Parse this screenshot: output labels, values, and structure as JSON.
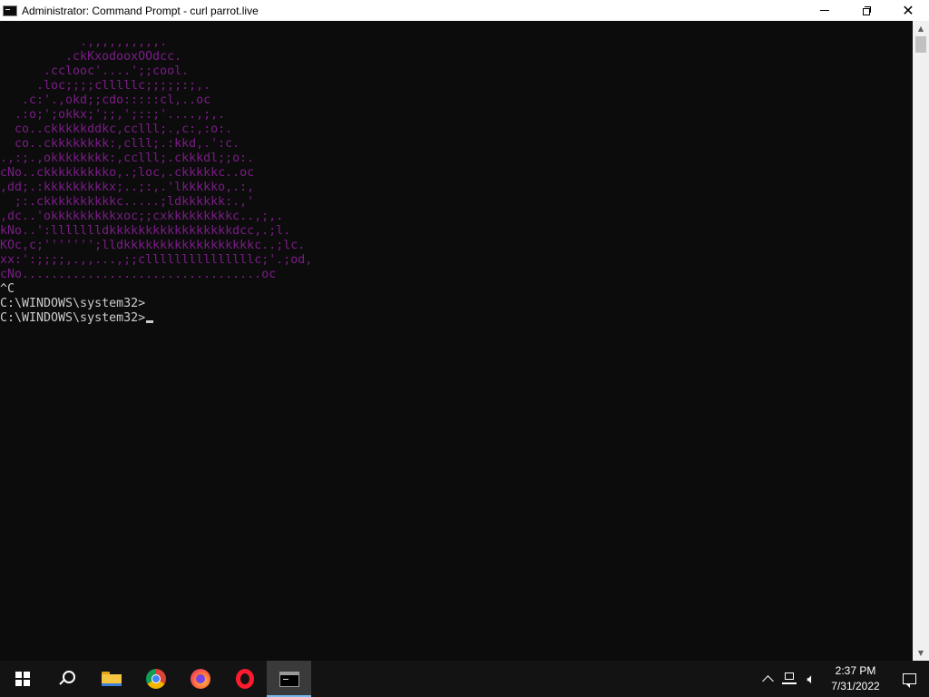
{
  "window": {
    "title": "Administrator: Command Prompt - curl  parrot.live"
  },
  "console": {
    "art_color": "#7a1d86",
    "text_color": "#cccccc",
    "art_lines": [
      "           .,,,,,,,,,,.",
      "         .ckKxodooxOOdcc.",
      "      .cclooc'....';;cool.",
      "     .loc;;;;clllllc;;;;;:;,.",
      "   .c:'.,okd;;cdo:::::cl,..oc",
      "  .:o;';okkx;';;,';::;'....,;,.",
      "  co..ckkkkkddkc,cclll;.,c:,:o:.",
      "  co..ckkkkkkkk:,clll;.:kkd,.':c.",
      ".,:;.,okkkkkkkk:,cclll;.ckkkdl;;o:.",
      "cNo..ckkkkkkkkko,.;loc,.ckkkkkc..oc",
      ",dd;.:kkkkkkkkkx;..;:,.'lkkkkko,.:,",
      "  ;:.ckkkkkkkkkkc.....;ldkkkkkk:.,'",
      ",dc..'okkkkkkkkkxoc;;cxkkkkkkkkkc..,;,.",
      "kNo..':llllllldkkkkkkkkkkkkkkkkkdcc,.;l.",
      "KOc,c;''''''';lldkkkkkkkkkkkkkkkkkkc..;lc.",
      "xx:':;;;;,.,,...,;;clllllllllllllllc;'.;od,",
      "cNo.................................oc"
    ],
    "after_lines": [
      "^C",
      "C:\\WINDOWS\\system32>",
      "C:\\WINDOWS\\system32>"
    ]
  },
  "taskbar": {
    "pinned": [
      {
        "name": "Start",
        "icon": "windows-icon"
      },
      {
        "name": "Search",
        "icon": "search-icon"
      },
      {
        "name": "File Explorer",
        "icon": "folder-icon"
      },
      {
        "name": "Google Chrome",
        "icon": "chrome-icon"
      },
      {
        "name": "Firefox",
        "icon": "firefox-icon"
      },
      {
        "name": "Opera",
        "icon": "opera-icon"
      },
      {
        "name": "Command Prompt",
        "icon": "cmd-icon",
        "active": true
      }
    ],
    "accent_color": "#76b9ed",
    "clock": {
      "time": "2:37 PM",
      "date": "7/31/2022"
    }
  }
}
